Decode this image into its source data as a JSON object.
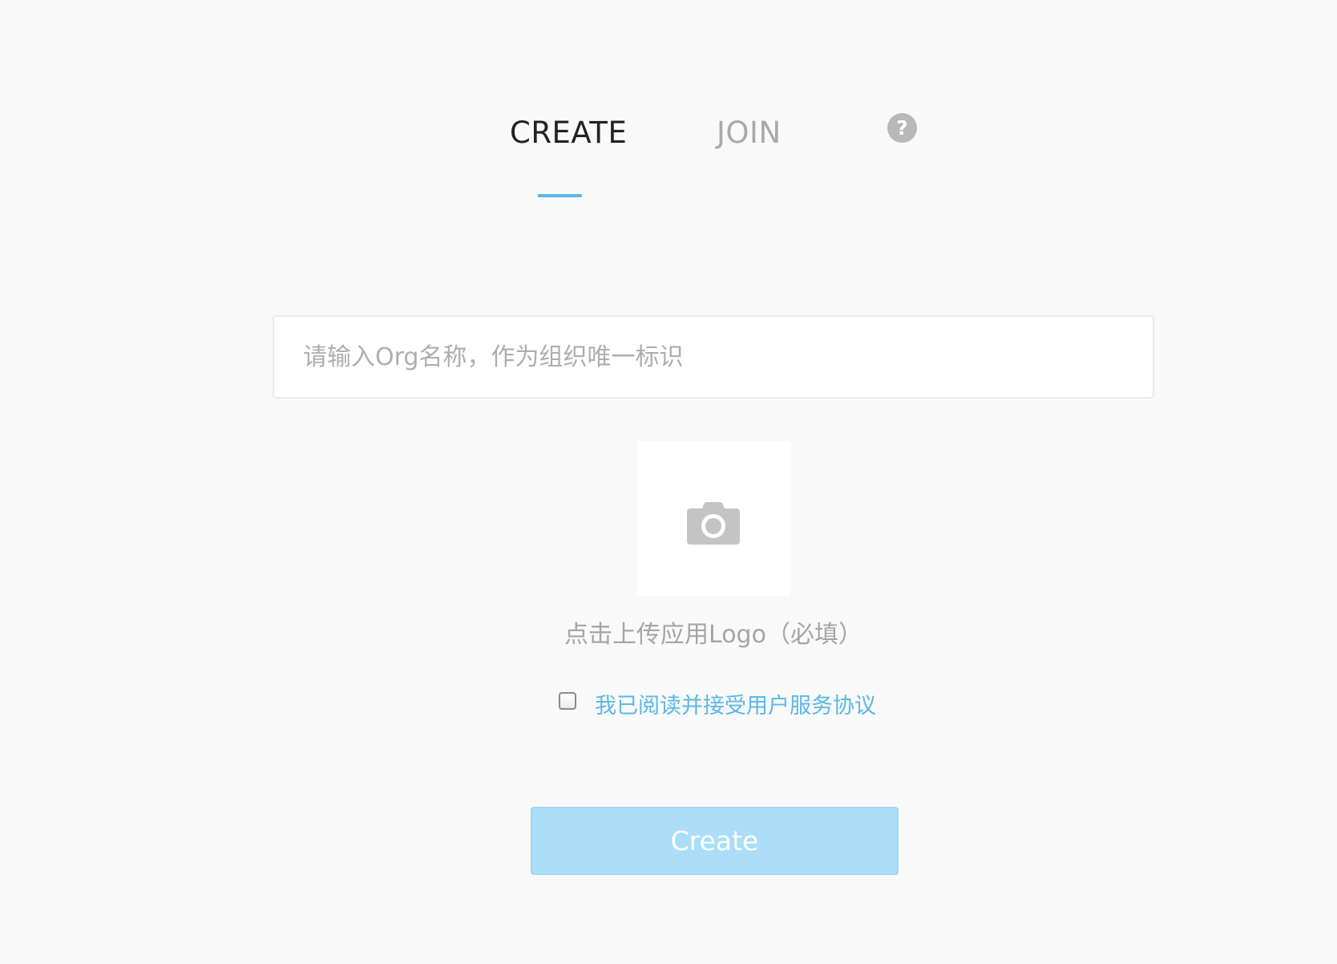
{
  "tabs": {
    "create_label": "CREATE",
    "join_label": "JOIN",
    "active": "CREATE",
    "help_icon": "question-circle-icon",
    "help_glyph": "?"
  },
  "form": {
    "org_name_placeholder": "请输入Org名称，作为组织唯一标识",
    "org_name_value": "",
    "logo_upload_icon": "camera-icon",
    "logo_upload_label": "点击上传应用Logo（必填）",
    "agreement_checked": false,
    "agreement_label": "我已阅读并接受用户服务协议",
    "submit_label": "Create"
  },
  "colors": {
    "accent": "#5bb8e8",
    "button_disabled_bg": "#abdef6",
    "background": "#f9f9f9"
  }
}
